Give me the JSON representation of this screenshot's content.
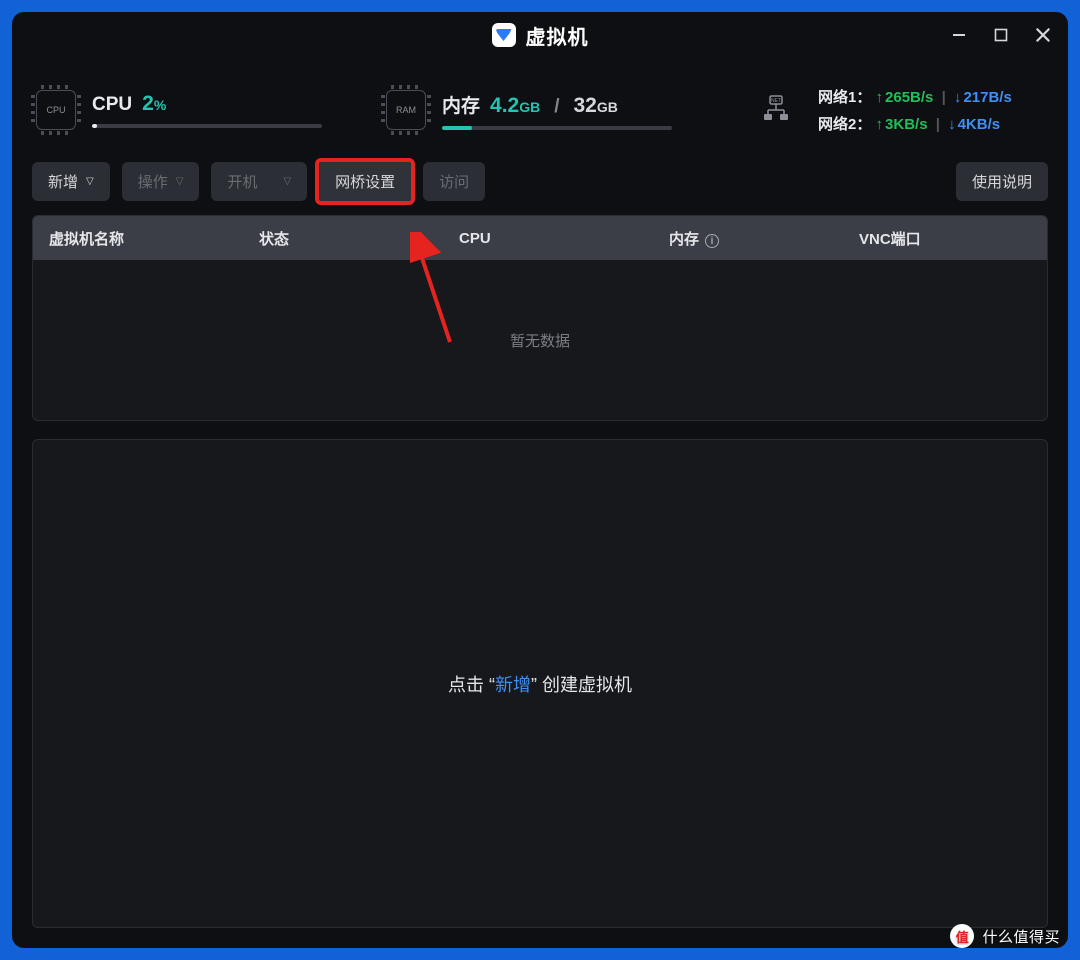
{
  "title": "虚拟机",
  "stats": {
    "cpu": {
      "label": "CPU",
      "value": "2",
      "unit": "%"
    },
    "mem": {
      "label": "内存",
      "used": "4.2",
      "used_unit": "GB",
      "total": "32",
      "total_unit": "GB"
    },
    "net": [
      {
        "label": "网络1：",
        "up": "265B/s",
        "down": "217B/s"
      },
      {
        "label": "网络2：",
        "up": "3KB/s",
        "down": "4KB/s"
      }
    ]
  },
  "toolbar": {
    "add": "新增",
    "action": "操作",
    "power": "开机",
    "bridge": "网桥设置",
    "visit": "访问",
    "help": "使用说明"
  },
  "columns": {
    "name": "虚拟机名称",
    "status": "状态",
    "cpu": "CPU",
    "mem": "内存",
    "vnc": "VNC端口"
  },
  "empty": "暂无数据",
  "promo": {
    "pre": "点击",
    "q1": "“",
    "accent": "新增",
    "q2": "”",
    "post": "创建虚拟机"
  },
  "watermark": {
    "badge": "值",
    "text": "什么值得买"
  },
  "colors": {
    "accent": "#3f8ff4",
    "teal": "#24c4b2",
    "red": "#e5231f",
    "green": "#1fbf5a"
  }
}
